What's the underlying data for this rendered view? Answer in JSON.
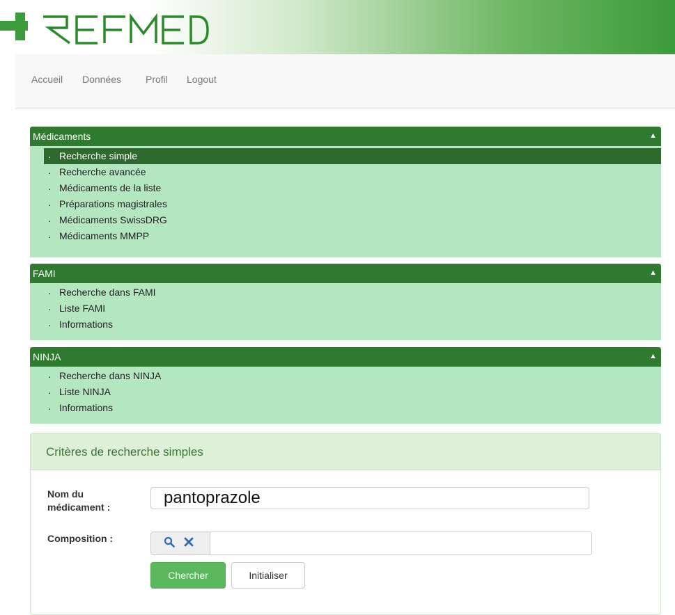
{
  "brand": {
    "logo_text": "REFMED",
    "accent": "#2e7a2e",
    "light_green": "#b4e6bf"
  },
  "nav": {
    "items": [
      "Accueil",
      "Données",
      "Profil",
      "Logout"
    ]
  },
  "menus": [
    {
      "title": "Médicaments",
      "toggle": "▲",
      "items": [
        "Recherche simple",
        "Recherche avancée",
        "Médicaments de la liste",
        "Préparations magistrales",
        "Médicaments SwissDRG",
        "Médicaments MMPP"
      ]
    },
    {
      "title": "FAMI",
      "toggle": "▲",
      "items": [
        "Recherche dans FAMI",
        "Liste FAMI",
        "Informations"
      ]
    },
    {
      "title": "NINJA",
      "toggle": "▲",
      "items": [
        "Recherche dans NINJA",
        "Liste NINJA",
        "Informations"
      ]
    }
  ],
  "bullet": "·",
  "search_panel": {
    "title": "Critères de recherche simples",
    "name_label_line1": "Nom du",
    "name_label_line2": "médicament :",
    "name_value": "pantoprazole",
    "composition_label": "Composition :",
    "composition_value": "",
    "search_icon": "search-icon",
    "clear_icon": "close-icon",
    "search_button": "Chercher",
    "reset_button": "Initialiser"
  }
}
